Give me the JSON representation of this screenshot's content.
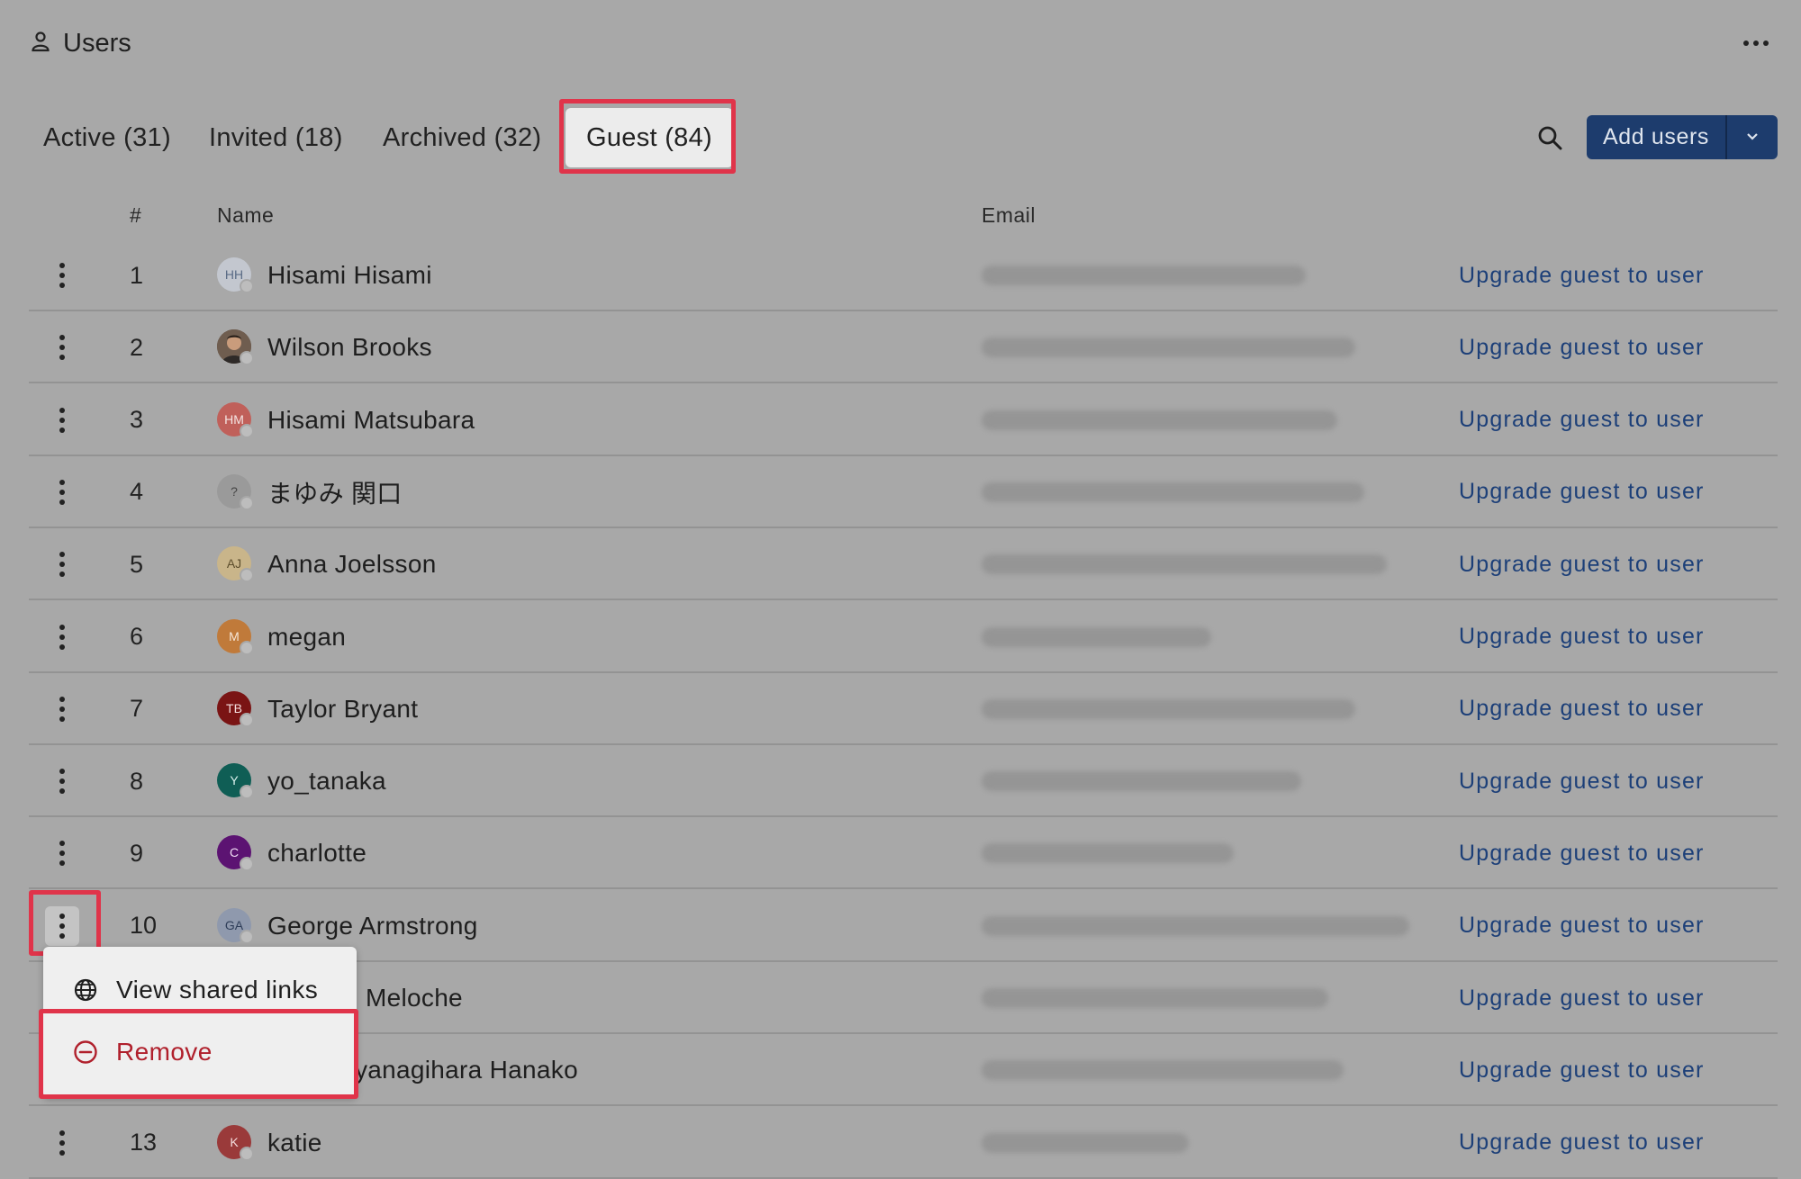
{
  "header": {
    "title": "Users",
    "more_icon": "more-horizontal-icon",
    "user_icon": "person-icon"
  },
  "tabs": [
    {
      "label": "Active (31)"
    },
    {
      "label": "Invited (18)"
    },
    {
      "label": "Archived (32)"
    },
    {
      "label": "Guest (84)",
      "selected": true
    }
  ],
  "toolbar": {
    "search_icon": "search-icon",
    "add_users_label": "Add users",
    "dropdown_icon": "chevron-down-icon"
  },
  "table": {
    "columns": {
      "num": "#",
      "name": "Name",
      "email": "Email"
    },
    "rows": [
      {
        "num": "1",
        "initials": "HH",
        "name": "Hisami Hisami",
        "action": "Upgrade guest to user",
        "avatar_color": "#c3c7cf",
        "initials_color": "#5a6b85"
      },
      {
        "num": "2",
        "initials": "",
        "name": "Wilson Brooks",
        "action": "Upgrade guest to user",
        "avatar_color": "#5b4a3e",
        "initials_color": "#f0f0f0",
        "photo": true
      },
      {
        "num": "3",
        "initials": "HM",
        "name": "Hisami Matsubara",
        "action": "Upgrade guest to user",
        "avatar_color": "#c0605a",
        "initials_color": "#f4e4e2"
      },
      {
        "num": "4",
        "initials": "?",
        "name": "まゆみ 関口",
        "action": "Upgrade guest to user",
        "avatar_color": "#9a9a9a",
        "initials_color": "#444444"
      },
      {
        "num": "5",
        "initials": "AJ",
        "name": "Anna Joelsson",
        "action": "Upgrade guest to user",
        "avatar_color": "#c9b58a",
        "initials_color": "#5c4d2c"
      },
      {
        "num": "6",
        "initials": "M",
        "name": "megan",
        "action": "Upgrade guest to user",
        "avatar_color": "#c07a3a",
        "initials_color": "#f6e6d6"
      },
      {
        "num": "7",
        "initials": "TB",
        "name": "Taylor Bryant",
        "action": "Upgrade guest to user",
        "avatar_color": "#7a1414",
        "initials_color": "#f4dede"
      },
      {
        "num": "8",
        "initials": "Y",
        "name": "yo_tanaka",
        "action": "Upgrade guest to user",
        "avatar_color": "#0f5e55",
        "initials_color": "#d8f0ec"
      },
      {
        "num": "9",
        "initials": "C",
        "name": "charlotte",
        "action": "Upgrade guest to user",
        "avatar_color": "#5c1372",
        "initials_color": "#efdcf4"
      },
      {
        "num": "10",
        "initials": "GA",
        "name": "George Armstrong",
        "action": "Upgrade guest to user",
        "avatar_color": "#8f99ad",
        "initials_color": "#2e3d58",
        "menu_open": true
      },
      {
        "num": "",
        "initials": "",
        "name": "Meloche",
        "action": "Upgrade guest to user",
        "hidden_lead": true
      },
      {
        "num": "",
        "initials": "",
        "name": "yanagihara Hanako",
        "action": "Upgrade guest to user",
        "hidden_lead": true
      },
      {
        "num": "13",
        "initials": "K",
        "name": "katie",
        "action": "Upgrade guest to user",
        "avatar_color": "#9a3a3a",
        "initials_color": "#f4dcdc"
      }
    ]
  },
  "context_menu": {
    "items": [
      {
        "label": "View shared links",
        "icon": "globe-icon",
        "color": "#1e1e1e"
      },
      {
        "label": "Remove",
        "icon": "minus-circle-icon",
        "color": "#b0202c"
      }
    ]
  },
  "colors": {
    "highlight": "#e0344a",
    "primary": "#1d3c6d",
    "link": "#1c3f78",
    "danger": "#b0202c"
  }
}
